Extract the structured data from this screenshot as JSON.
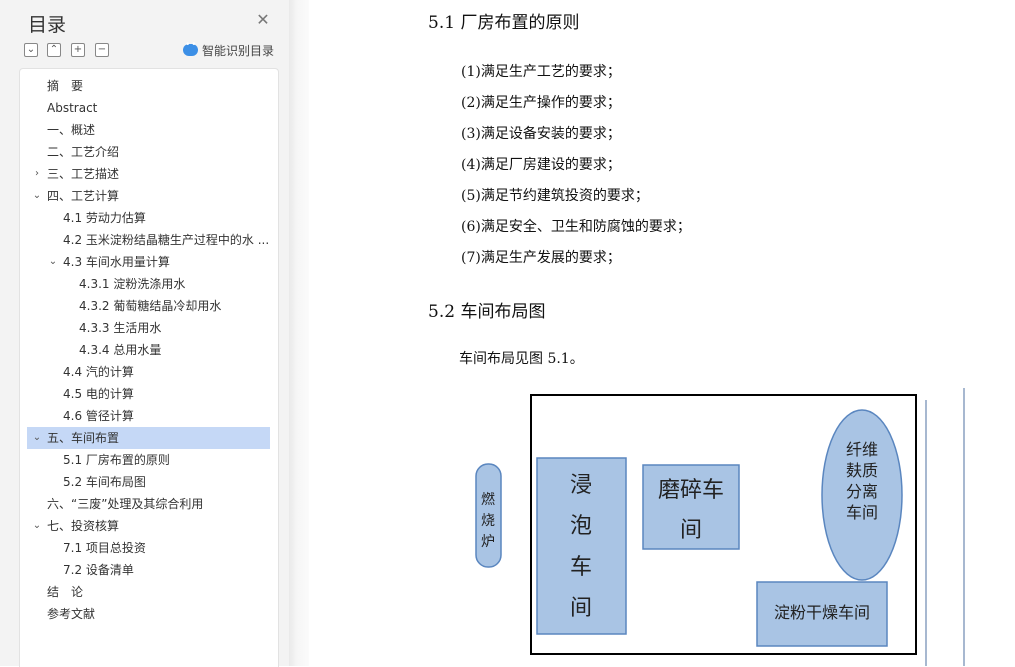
{
  "sidebar": {
    "title": "目录",
    "close_icon": "close-icon",
    "toolbar_icons": [
      "collapse-all-icon",
      "expand-all-icon",
      "add-heading-icon",
      "remove-heading-icon"
    ],
    "toolbar_glyphs": [
      "⌄",
      "⌃",
      "+",
      "−"
    ],
    "smart_label": "智能识别目录",
    "toc": [
      {
        "label": "摘　要",
        "level": 0,
        "chevron": ""
      },
      {
        "label": "Abstract",
        "level": 0,
        "chevron": ""
      },
      {
        "label": "一、概述",
        "level": 0,
        "chevron": ""
      },
      {
        "label": "二、工艺介绍",
        "level": 0,
        "chevron": ""
      },
      {
        "label": "三、工艺描述",
        "level": 0,
        "chevron": "›"
      },
      {
        "label": "四、工艺计算",
        "level": 0,
        "chevron": "⌄"
      },
      {
        "label": "4.1 劳动力估算",
        "level": 1,
        "chevron": ""
      },
      {
        "label": "4.2 玉米淀粉结晶糖生产过程中的水 ...",
        "level": 1,
        "chevron": ""
      },
      {
        "label": "4.3 车间水用量计算",
        "level": 1,
        "chevron": "⌄"
      },
      {
        "label": "4.3.1 淀粉洗涤用水",
        "level": 2,
        "chevron": ""
      },
      {
        "label": "4.3.2  葡萄糖结晶冷却用水",
        "level": 2,
        "chevron": ""
      },
      {
        "label": "4.3.3  生活用水",
        "level": 2,
        "chevron": ""
      },
      {
        "label": "4.3.4  总用水量",
        "level": 2,
        "chevron": ""
      },
      {
        "label": "4.4  汽的计算",
        "level": 1,
        "chevron": ""
      },
      {
        "label": "4.5  电的计算",
        "level": 1,
        "chevron": ""
      },
      {
        "label": "4.6  管径计算",
        "level": 1,
        "chevron": ""
      },
      {
        "label": "五、车间布置",
        "level": 0,
        "chevron": "⌄",
        "selected": true
      },
      {
        "label": "5.1 厂房布置的原则",
        "level": 1,
        "chevron": ""
      },
      {
        "label": "5.2 车间布局图",
        "level": 1,
        "chevron": ""
      },
      {
        "label": "六、“三废”处理及其综合利用",
        "level": 0,
        "chevron": ""
      },
      {
        "label": "七、投资核算",
        "level": 0,
        "chevron": "⌄"
      },
      {
        "label": "7.1 项目总投资",
        "level": 1,
        "chevron": ""
      },
      {
        "label": "7.2 设备清单",
        "level": 1,
        "chevron": ""
      },
      {
        "label": "结　论",
        "level": 0,
        "chevron": ""
      },
      {
        "label": "参考文献",
        "level": 0,
        "chevron": ""
      }
    ]
  },
  "document": {
    "heading_51": "5.1 厂房布置的原则",
    "requirements": [
      "(1)满足生产工艺的要求；",
      "(2)满足生产操作的要求；",
      "(3)满足设备安装的要求；",
      "(4)满足厂房建设的要求；",
      "(5)满足节约建筑投资的要求；",
      "(6)满足安全、卫生和防腐蚀的要求；",
      "(7)满足生产发展的要求；"
    ],
    "heading_52": "5.2 车间布局图",
    "paragraph": "车间布局见图 5.1。",
    "figure": {
      "boiler": [
        "燃",
        "烧",
        "炉"
      ],
      "soaking": [
        "浸",
        "泡",
        "车",
        "间"
      ],
      "grinding": [
        "磨碎车",
        "间"
      ],
      "fiber": [
        "纤维",
        "麸质",
        "分离",
        "车间"
      ],
      "drying": "淀粉干燥车间",
      "box_fill": "#a9c4e4",
      "box_stroke": "#5a86bf"
    }
  }
}
